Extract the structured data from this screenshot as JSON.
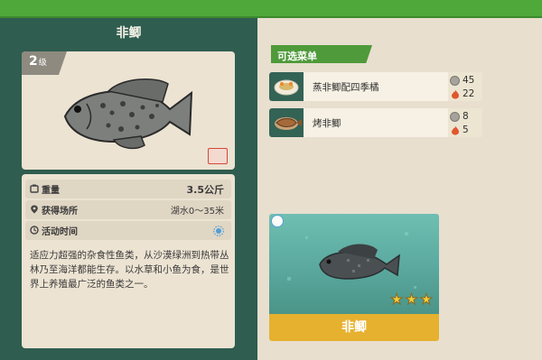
{
  "fish": {
    "name": "非鲫",
    "level": "2",
    "level_unit": "级",
    "weight_label": "重量",
    "weight_value": "3.5公斤",
    "location_label": "获得场所",
    "location_value": "湖水0～35米",
    "activity_label": "活动时间",
    "description": "适应力超强的杂食性鱼类，从沙漠绿洲到热带丛林乃至海洋都能生存。以水草和小鱼为食，是世界上养殖最广泛的鱼类之一。"
  },
  "menu": {
    "header": "可选菜单",
    "dishes": [
      {
        "name": "蒸非鲫配四季橘",
        "coin_cost": "45",
        "fire_cost": "22"
      },
      {
        "name": "烤非鲫",
        "coin_cost": "8",
        "fire_cost": "5"
      }
    ]
  },
  "preview": {
    "title": "非鲫",
    "stars": 3
  },
  "colors": {
    "panel_green": "#2f5d50",
    "topbar_green": "#4fa83a",
    "card_beige": "#ece3d2",
    "title_gold": "#e6b12f",
    "star_gold": "#f2cd3a"
  }
}
